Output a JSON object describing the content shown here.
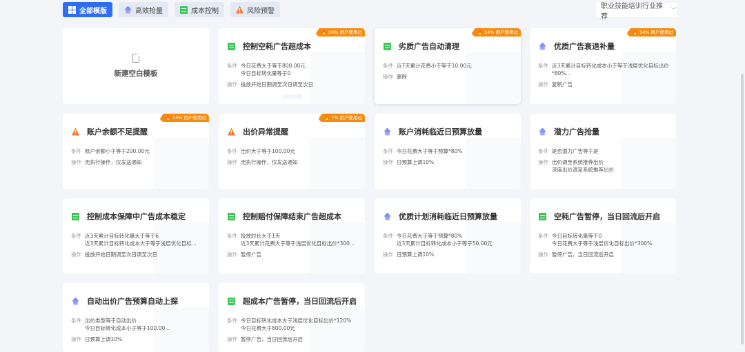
{
  "tabs": [
    {
      "label": "全部模版",
      "icon": "grid-icon",
      "active": true
    },
    {
      "label": "高效抢量",
      "icon": "arrow-up-icon"
    },
    {
      "label": "成本控制",
      "icon": "cost-icon"
    },
    {
      "label": "风险预警",
      "icon": "warning-icon"
    }
  ],
  "industry_select": {
    "value": "职业技能培训行业推荐"
  },
  "blank_card": {
    "label": "新建空白模板"
  },
  "labels": {
    "condition": "条件",
    "action": "操作"
  },
  "colors": {
    "accent": "#2f6ef0",
    "badge": "#f58c0f",
    "cost": "#3fc45a",
    "warning": "#f5782c",
    "boost": "#6f7ff5"
  },
  "cards": [
    {
      "title": "控制空耗广告超成本",
      "icon": "cost",
      "badge": "🔥 26% 用户使用过",
      "conditions": [
        "今日花费大于等于800.00元",
        "今日目标转化量等于0"
      ],
      "actions": [
        "投放开始日期调至次日调至次日"
      ],
      "hover_text": "开始创建"
    },
    {
      "title": "劣质广告自动清理",
      "icon": "cost",
      "badge": "🔥 14% 用户使用过",
      "conditions": [
        "近7天累计花费小于等于10.00元"
      ],
      "actions": [
        "删除"
      ],
      "hover": true
    },
    {
      "title": "优质广告衰退补量",
      "icon": "up",
      "badge": "🔥 14% 用户使用过",
      "conditions": [
        "近3天累计目标转化成本小于等于浅层优化目标出价*80%..."
      ],
      "actions": [
        "复制广告"
      ]
    },
    {
      "title": "账户余额不足提醒",
      "icon": "warn",
      "badge": "🔥 13% 用户使用过",
      "conditions": [
        "账户余额小于等于200.00元"
      ],
      "actions": [
        "无执行操作，仅发送通知"
      ]
    },
    {
      "title": "出价异常提醒",
      "icon": "warn",
      "badge": "🔥 7% 用户使用过",
      "conditions": [
        "出价大于等于100.00元"
      ],
      "actions": [
        "无执行操作，仅发送通知"
      ]
    },
    {
      "title": "账户消耗临近日预算放量",
      "icon": "up",
      "conditions": [
        "今日花费大于等于预算*80%"
      ],
      "actions": [
        "日预算上调10%"
      ]
    },
    {
      "title": "潜力广告抢量",
      "icon": "up",
      "conditions": [
        "是否潜力广告等于是"
      ],
      "actions": [
        "出价调至系统推荐出价",
        "深度出价调至系统推荐出价"
      ]
    },
    {
      "title": "控制成本保障中广告成本稳定",
      "icon": "cost",
      "conditions": [
        "近3天累计目标转化量大于等于6",
        "近3天累计目标转化成本大于等于浅层优化目标..."
      ],
      "actions": [
        "投放开始日期调至次日调至次日"
      ]
    },
    {
      "title": "控制赔付保障结束广告超成本",
      "icon": "cost",
      "conditions": [
        "投放时长大于1天",
        "近3天累计花费大于等于浅层优化目标出价*300..."
      ],
      "actions": [
        "暂停广告"
      ]
    },
    {
      "title": "优质计划消耗临近日预算放量",
      "icon": "up",
      "conditions": [
        "今日花费大于等于预算*80%",
        "近3天累计目标转化成本小于等于50.00元"
      ],
      "actions": [
        "日预算上调10%"
      ]
    },
    {
      "title": "空耗广告暂停，当日回流后开启",
      "icon": "cost",
      "conditions": [
        "今日目标转化量等于0",
        "今日花费大于等于浅层优化目标出价*300%"
      ],
      "actions": [
        "暂停广告，当日回流后开启"
      ]
    },
    {
      "title": "自动出价广告预算自动上探",
      "icon": "up",
      "conditions": [
        "出价类型等于自动出价",
        "今日目标转化成本小于等于100.00..."
      ],
      "actions": [
        "日预算上调10%"
      ]
    },
    {
      "title": "超成本广告暂停，当日回流后开启",
      "icon": "cost",
      "conditions": [
        "今日目标转化成本大于浅层优化目标出价*120%",
        "今日花费大于800.00元"
      ],
      "actions": [
        "暂停广告，当日回流后开启"
      ]
    }
  ]
}
